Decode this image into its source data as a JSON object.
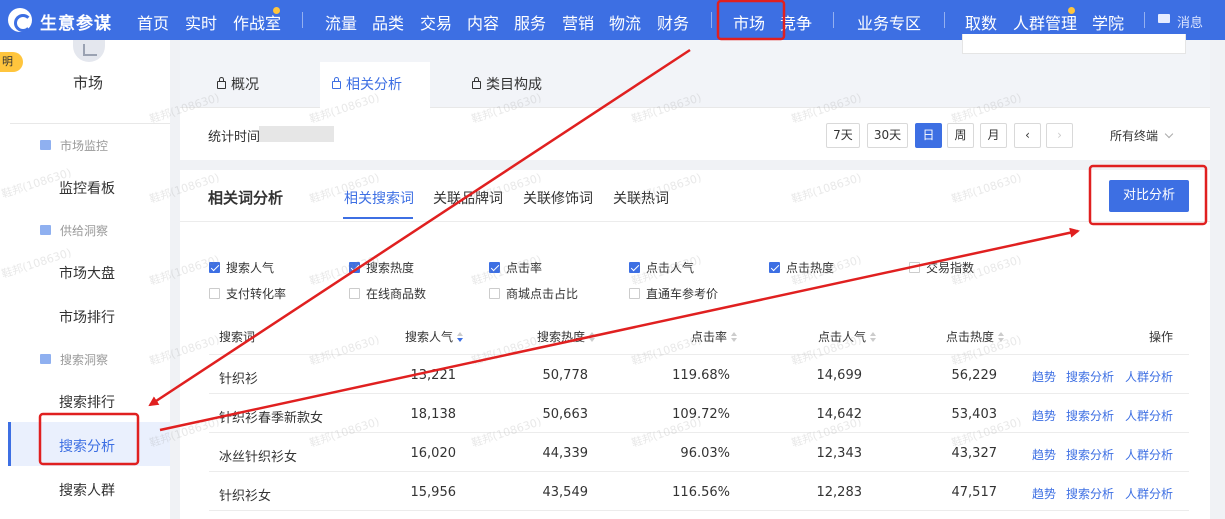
{
  "brand": "生意参谋",
  "nav": {
    "items": [
      "首页",
      "实时",
      "作战室",
      "流量",
      "品类",
      "交易",
      "内容",
      "服务",
      "营销",
      "物流",
      "财务",
      "市场",
      "竞争",
      "业务专区",
      "取数",
      "人群管理",
      "学院"
    ],
    "active": "市场",
    "message": "消息"
  },
  "sidebar": {
    "badge": "明",
    "title": "市场",
    "groups": [
      {
        "label": "市场监控",
        "items": [
          "监控看板"
        ]
      },
      {
        "label": "供给洞察",
        "items": [
          "市场大盘",
          "市场排行"
        ]
      },
      {
        "label": "搜索洞察",
        "items": [
          "搜索排行",
          "搜索分析",
          "搜索人群"
        ]
      }
    ],
    "active_item": "搜索分析"
  },
  "tabs": [
    "概况",
    "相关分析",
    "类目构成"
  ],
  "active_tab": "相关分析",
  "stat_time_label": "统计时间",
  "date_buttons": [
    "7天",
    "30天",
    "日",
    "周",
    "月",
    "‹",
    "›"
  ],
  "active_date": "日",
  "terminal": "所有终端",
  "section_title": "相关词分析",
  "subtabs": [
    "相关搜索词",
    "关联品牌词",
    "关联修饰词",
    "关联热词"
  ],
  "active_subtab": "相关搜索词",
  "compare_button": "对比分析",
  "checkboxes": [
    {
      "label": "搜索人气",
      "checked": true
    },
    {
      "label": "搜索热度",
      "checked": true
    },
    {
      "label": "点击率",
      "checked": true
    },
    {
      "label": "点击人气",
      "checked": true
    },
    {
      "label": "点击热度",
      "checked": true
    },
    {
      "label": "交易指数",
      "checked": false
    },
    {
      "label": "支付转化率",
      "checked": false
    },
    {
      "label": "在线商品数",
      "checked": false
    },
    {
      "label": "商城点击占比",
      "checked": false
    },
    {
      "label": "直通车参考价",
      "checked": false
    }
  ],
  "table": {
    "columns": [
      "搜索词",
      "搜索人气",
      "搜索热度",
      "点击率",
      "点击人气",
      "点击热度",
      "操作"
    ],
    "rows": [
      {
        "keyword": "针织衫",
        "search_pop": "13,221",
        "search_heat": "50,778",
        "ctr": "119.68%",
        "click_pop": "14,699",
        "click_heat": "56,229"
      },
      {
        "keyword": "针织衫春季新款女",
        "search_pop": "18,138",
        "search_heat": "50,663",
        "ctr": "109.72%",
        "click_pop": "14,642",
        "click_heat": "53,403"
      },
      {
        "keyword": "冰丝针织衫女",
        "search_pop": "16,020",
        "search_heat": "44,339",
        "ctr": "96.03%",
        "click_pop": "12,343",
        "click_heat": "43,327"
      },
      {
        "keyword": "针织衫女",
        "search_pop": "15,956",
        "search_heat": "43,549",
        "ctr": "116.56%",
        "click_pop": "12,283",
        "click_heat": "47,517"
      }
    ],
    "actions": [
      "趋势",
      "搜索分析",
      "人群分析"
    ]
  },
  "watermark": "鞋邦(108630)",
  "colors": {
    "brand": "#3d6fe3",
    "annotation": "#e02020",
    "highlight": "#ffc53d"
  }
}
